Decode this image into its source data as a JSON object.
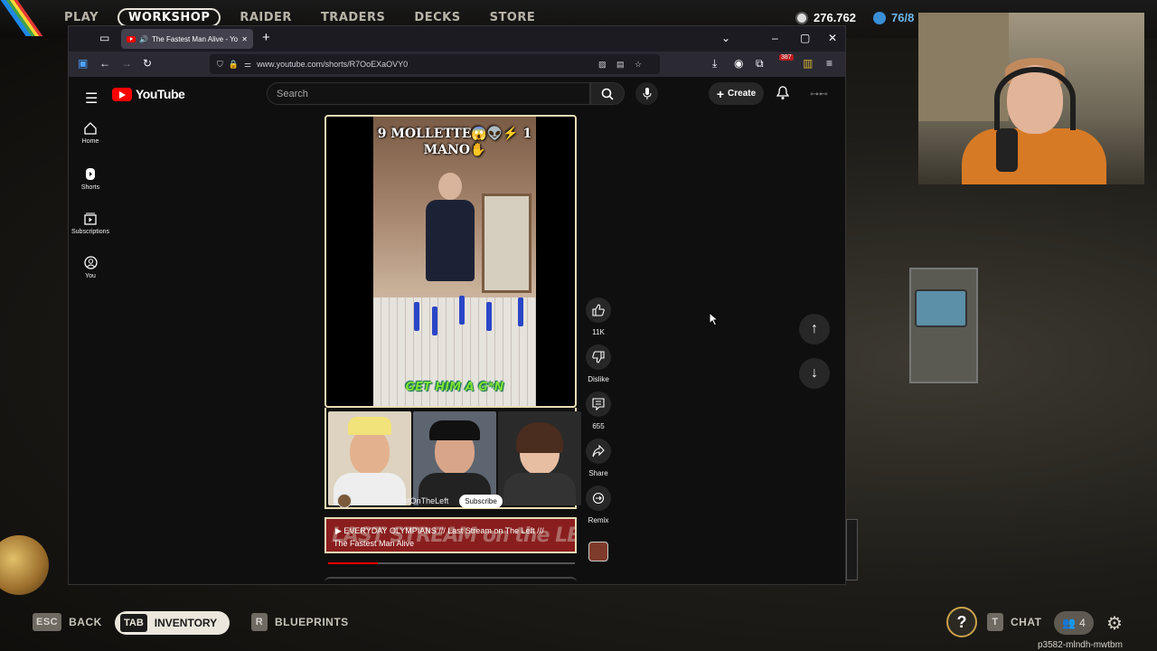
{
  "game": {
    "nav": [
      "PLAY",
      "WORKSHOP",
      "RAIDER",
      "TRADERS",
      "DECKS",
      "STORE"
    ],
    "active_nav": "WORKSHOP",
    "currency1": "276.762",
    "currency2": "76/8"
  },
  "browser": {
    "tab_title": "The Fastest Man Alive - You",
    "url": "www.youtube.com/shorts/R7OoEXaOVY0",
    "badge": "387"
  },
  "youtube": {
    "logo": "YouTube",
    "search_placeholder": "Search",
    "create_label": "Create",
    "sidebar": [
      {
        "label": "Home"
      },
      {
        "label": "Shorts"
      },
      {
        "label": "Subscriptions"
      },
      {
        "label": "You"
      }
    ],
    "short": {
      "overlay_title": "9 MOLLETTE😱👽⚡ 1 MANO✋",
      "overlay_caption": "GET HIM A G*N",
      "channel": "@LastPodcastOnTheLeft",
      "subscribe": "Subscribe",
      "stream_banner": "EVERYDAY OLYMPIANS /// Last Stream on The Left ///",
      "banner_big": "LAST STREAM on the LEFT",
      "title": "The Fastest Man Alive",
      "progress": 0.2
    },
    "actions": {
      "likes": "11K",
      "dislike": "Dislike",
      "comments": "655",
      "share": "Share",
      "remix": "Remix"
    }
  },
  "bottom": {
    "esc_key": "ESC",
    "back": "BACK",
    "tab_key": "TAB",
    "inventory": "INVENTORY",
    "r_key": "R",
    "blueprints": "BLUEPRINTS",
    "help": "?",
    "t_key": "T",
    "chat": "CHAT",
    "party_count": "4",
    "session_id": "p3582-mlndh-mwtbm"
  }
}
